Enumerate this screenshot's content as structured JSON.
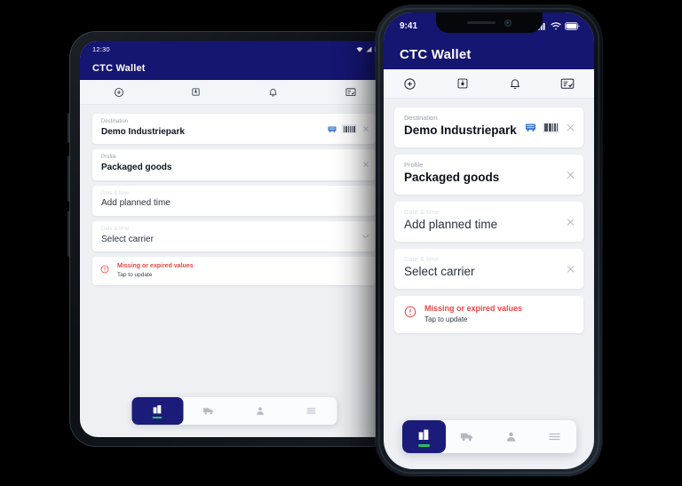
{
  "meta": {
    "background_color": "#000000",
    "brand_navy": "#151572",
    "accent_navy": "#1b1b7a",
    "danger_red": "#ef4444",
    "green_indicator": "#22c55e"
  },
  "tablet": {
    "device": "android-tablet",
    "status_bar": {
      "time": "12:30",
      "icons": [
        "wifi-icon",
        "signal-icon",
        "battery-icon"
      ]
    },
    "header": {
      "title": "CTC Wallet"
    },
    "toolbar": [
      {
        "name": "add-icon",
        "label": "Add"
      },
      {
        "name": "archive-box-icon",
        "label": "Archive"
      },
      {
        "name": "bell-icon",
        "label": "Notifications"
      },
      {
        "name": "checklist-icon",
        "label": "Forms"
      }
    ],
    "fields": [
      {
        "label": "Destination",
        "value": "Demo Industriepark",
        "label_faded": false,
        "value_bold": true,
        "trailing": [
          "truck-icon",
          "barcode-icon",
          "close-icon"
        ]
      },
      {
        "label": "Profile",
        "value": "Packaged goods",
        "label_faded": false,
        "value_bold": true,
        "trailing": [
          "close-icon"
        ]
      },
      {
        "label": "Date & time",
        "value": "Add planned time",
        "label_faded": true,
        "value_bold": false,
        "trailing": []
      },
      {
        "label": "Date & time",
        "value": "Select carrier",
        "label_faded": true,
        "value_bold": false,
        "trailing": [
          "chevron-down-icon"
        ]
      }
    ],
    "warning": {
      "title": "Missing or expired values",
      "subtitle": "Tap to update",
      "icon": "alert-circle-icon"
    },
    "nav": [
      {
        "name": "nav-buildings",
        "icon": "buildings-icon",
        "active": true
      },
      {
        "name": "nav-truck",
        "icon": "truck-icon",
        "active": false
      },
      {
        "name": "nav-profile",
        "icon": "person-icon",
        "active": false
      },
      {
        "name": "nav-menu",
        "icon": "hamburger-icon",
        "active": false
      }
    ]
  },
  "phone": {
    "device": "iphone",
    "status_bar": {
      "time": "9:41",
      "icons": [
        "signal-icon",
        "wifi-icon",
        "battery-icon"
      ]
    },
    "header": {
      "title": "CTC Wallet"
    },
    "toolbar": [
      {
        "name": "add-icon",
        "label": "Add"
      },
      {
        "name": "archive-box-icon",
        "label": "Archive"
      },
      {
        "name": "bell-icon",
        "label": "Notifications"
      },
      {
        "name": "checklist-icon",
        "label": "Forms"
      }
    ],
    "fields": [
      {
        "label": "Destination",
        "value": "Demo Industriepark",
        "label_faded": false,
        "value_bold": true,
        "trailing": [
          "truck-icon",
          "barcode-icon",
          "close-icon"
        ]
      },
      {
        "label": "Profile",
        "value": "Packaged goods",
        "label_faded": false,
        "value_bold": true,
        "trailing": [
          "close-icon"
        ]
      },
      {
        "label": "Date & time",
        "value": "Add planned time",
        "label_faded": true,
        "value_bold": false,
        "trailing": [
          "close-icon"
        ]
      },
      {
        "label": "Date & time",
        "value": "Select carrier",
        "label_faded": true,
        "value_bold": false,
        "trailing": [
          "close-icon"
        ]
      }
    ],
    "warning": {
      "title": "Missing or expired values",
      "subtitle": "Tap to update",
      "icon": "alert-circle-icon"
    },
    "nav": [
      {
        "name": "nav-buildings",
        "icon": "buildings-icon",
        "active": true
      },
      {
        "name": "nav-truck",
        "icon": "truck-icon",
        "active": false
      },
      {
        "name": "nav-profile",
        "icon": "person-icon",
        "active": false
      },
      {
        "name": "nav-menu",
        "icon": "hamburger-icon",
        "active": false
      }
    ]
  }
}
